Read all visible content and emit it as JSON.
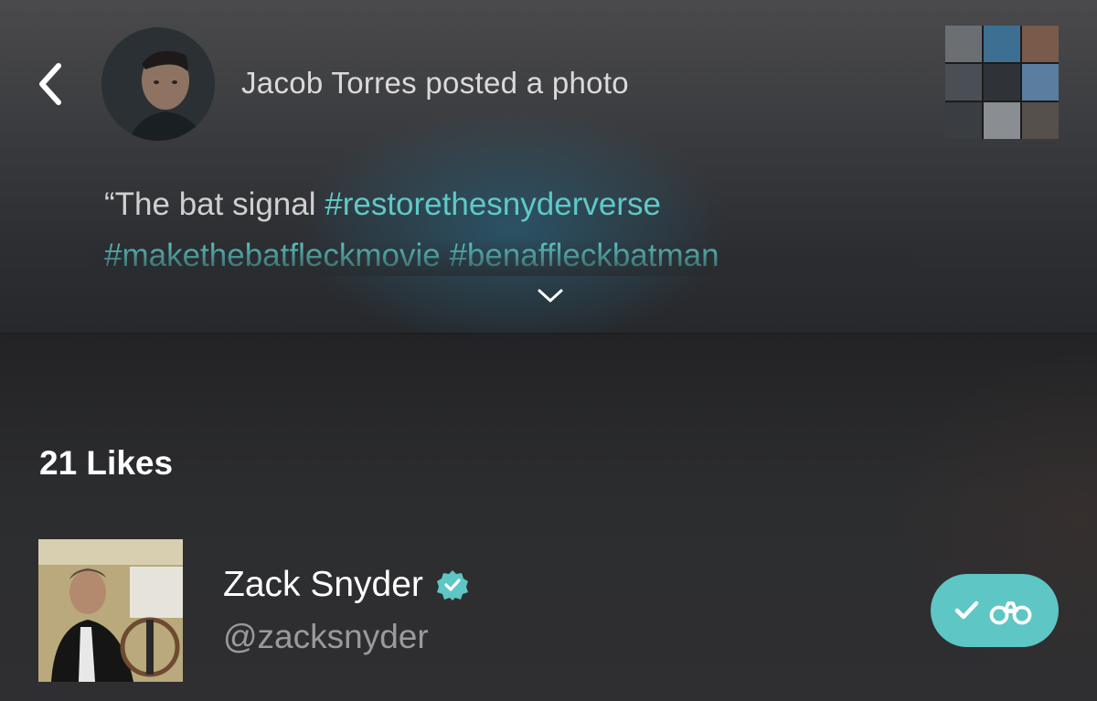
{
  "header": {
    "post_title": "Jacob Torres posted a photo",
    "back_icon": "chevron-left-icon",
    "expand_icon": "chevron-down-icon"
  },
  "caption": {
    "line1_text": "“The bat signal ",
    "line1_tag": "#restorethesnyderverse",
    "line2_tag1": "#makethebatfleckmovie",
    "line2_tag2": "#benaffleckbatman"
  },
  "likes": {
    "count_label": "21 Likes",
    "users": [
      {
        "name": "Zack Snyder",
        "handle": "@zacksnyder",
        "verified": true,
        "following": true,
        "follow_icon": "check-binoculars-icon"
      }
    ]
  },
  "colors": {
    "accent": "#5ec6c4",
    "hashtag": "#5ec9c7",
    "background": "#262628"
  }
}
